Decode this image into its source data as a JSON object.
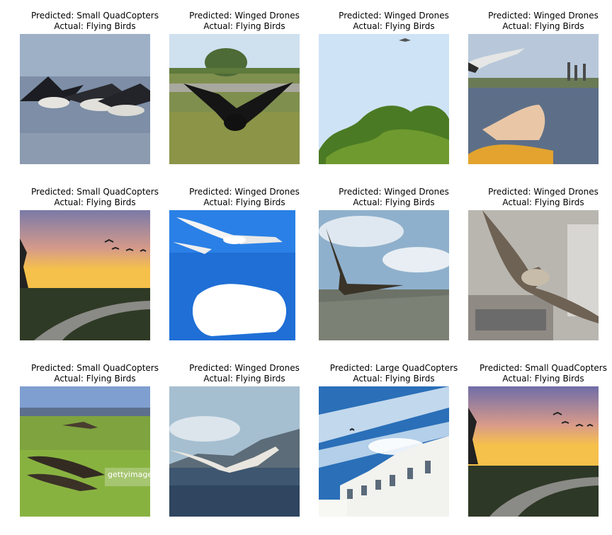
{
  "figure": {
    "cells": [
      {
        "predicted": "Predicted: Small QuadCopters",
        "actual": "Actual: Flying Birds"
      },
      {
        "predicted": "Predicted: Winged Drones",
        "actual": "Actual: Flying Birds"
      },
      {
        "predicted": "Predicted: Winged Drones",
        "actual": "Actual: Flying Birds"
      },
      {
        "predicted": "Predicted: Winged Drones",
        "actual": "Actual: Flying Birds"
      },
      {
        "predicted": "Predicted: Small QuadCopters",
        "actual": "Actual: Flying Birds"
      },
      {
        "predicted": "Predicted: Winged Drones",
        "actual": "Actual: Flying Birds"
      },
      {
        "predicted": "Predicted: Winged Drones",
        "actual": "Actual: Flying Birds"
      },
      {
        "predicted": "Predicted: Winged Drones",
        "actual": "Actual: Flying Birds"
      },
      {
        "predicted": "Predicted: Small QuadCopters",
        "actual": "Actual: Flying Birds"
      },
      {
        "predicted": "Predicted: Winged Drones",
        "actual": "Actual: Flying Birds"
      },
      {
        "predicted": "Predicted: Large QuadCopters",
        "actual": "Actual: Flying Birds"
      },
      {
        "predicted": "Predicted: Small QuadCopters",
        "actual": "Actual: Flying Birds"
      }
    ],
    "watermark": "gettyimages"
  }
}
